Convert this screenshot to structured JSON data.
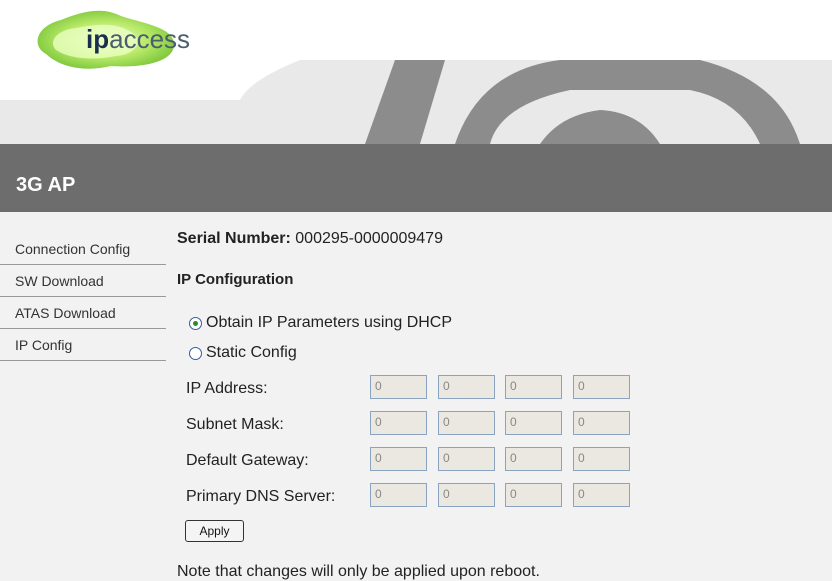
{
  "brand": {
    "logo_bold": "ip",
    "logo_rest": "access"
  },
  "header": {
    "title": "3G AP"
  },
  "sidebar": {
    "items": [
      {
        "label": "Connection Config"
      },
      {
        "label": "SW Download"
      },
      {
        "label": "ATAS Download"
      },
      {
        "label": "IP Config"
      }
    ]
  },
  "main": {
    "serial_label": "Serial Number:",
    "serial_value": "000295-0000009479",
    "section_title": "IP Configuration",
    "options": [
      {
        "label": "Obtain IP Parameters using DHCP",
        "checked": true
      },
      {
        "label": "Static Config",
        "checked": false
      }
    ],
    "fields": [
      {
        "label": "IP Address:",
        "octets": [
          "0",
          "0",
          "0",
          "0"
        ]
      },
      {
        "label": "Subnet Mask:",
        "octets": [
          "0",
          "0",
          "0",
          "0"
        ]
      },
      {
        "label": "Default Gateway:",
        "octets": [
          "0",
          "0",
          "0",
          "0"
        ]
      },
      {
        "label": "Primary DNS Server:",
        "octets": [
          "0",
          "0",
          "0",
          "0"
        ]
      }
    ],
    "apply_label": "Apply",
    "note": "Note that changes will only be applied upon reboot."
  },
  "colors": {
    "title_bar": "#6d6d6d",
    "banner_arcs": "#8c8c8c",
    "logo_green": "#8fd14f",
    "radio_selected": "#2e8a2e"
  }
}
